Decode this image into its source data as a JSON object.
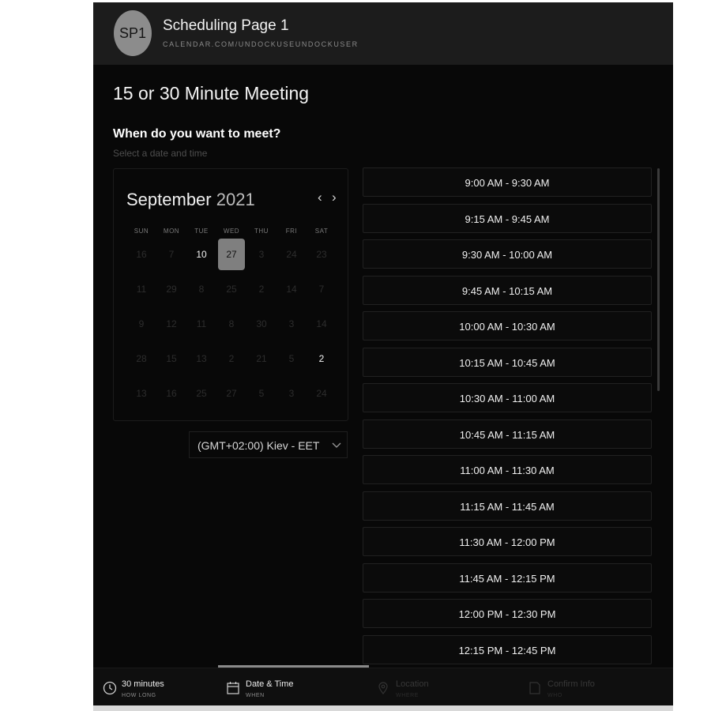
{
  "header": {
    "avatar_initials": "SP1",
    "page_title": "Scheduling Page 1",
    "page_url": "CALENDAR.COM/UNDOCKUSEUNDOCKUSER"
  },
  "meeting": {
    "title": "15 or 30 Minute Meeting",
    "when_heading": "When do you want to meet?",
    "when_subtitle": "Select a date and time"
  },
  "calendar": {
    "month": "September",
    "year": "2021",
    "prev_icon": "chevron-left-icon",
    "next_icon": "chevron-right-icon",
    "weekdays": [
      "SUN",
      "MON",
      "TUE",
      "WED",
      "THU",
      "FRI",
      "SAT"
    ],
    "weeks": [
      [
        "16",
        "7",
        "10",
        "27",
        "3",
        "24",
        "23"
      ],
      [
        "11",
        "29",
        "8",
        "25",
        "2",
        "14",
        "7"
      ],
      [
        "9",
        "12",
        "11",
        "8",
        "30",
        "3",
        "14"
      ],
      [
        "28",
        "15",
        "13",
        "2",
        "21",
        "5",
        "2"
      ],
      [
        "13",
        "16",
        "25",
        "27",
        "5",
        "3",
        "24"
      ]
    ],
    "available": [
      [
        0,
        2
      ],
      [
        0,
        3
      ],
      [
        3,
        6
      ]
    ],
    "selected": [
      0,
      3
    ]
  },
  "timezone": {
    "label": "(GMT+02:00) Kiev - EET",
    "icon": "chevron-down-icon"
  },
  "time_slots": [
    "9:00 AM - 9:30 AM",
    "9:15 AM - 9:45 AM",
    "9:30 AM - 10:00 AM",
    "9:45 AM - 10:15 AM",
    "10:00 AM - 10:30 AM",
    "10:15 AM - 10:45 AM",
    "10:30 AM - 11:00 AM",
    "10:45 AM - 11:15 AM",
    "11:00 AM - 11:30 AM",
    "11:15 AM - 11:45 AM",
    "11:30 AM - 12:00 PM",
    "11:45 AM - 12:15 PM",
    "12:00 PM - 12:30 PM",
    "12:15 PM - 12:45 PM"
  ],
  "steps": [
    {
      "label": "30 minutes",
      "sub": "HOW LONG",
      "icon": "clock-icon",
      "state": "done"
    },
    {
      "label": "Date & Time",
      "sub": "WHEN",
      "icon": "calendar-icon",
      "state": "active"
    },
    {
      "label": "Location",
      "sub": "WHERE",
      "icon": "location-pin-icon",
      "state": "disabled"
    },
    {
      "label": "Confirm Info",
      "sub": "WHO",
      "icon": "document-icon",
      "state": "disabled"
    }
  ]
}
